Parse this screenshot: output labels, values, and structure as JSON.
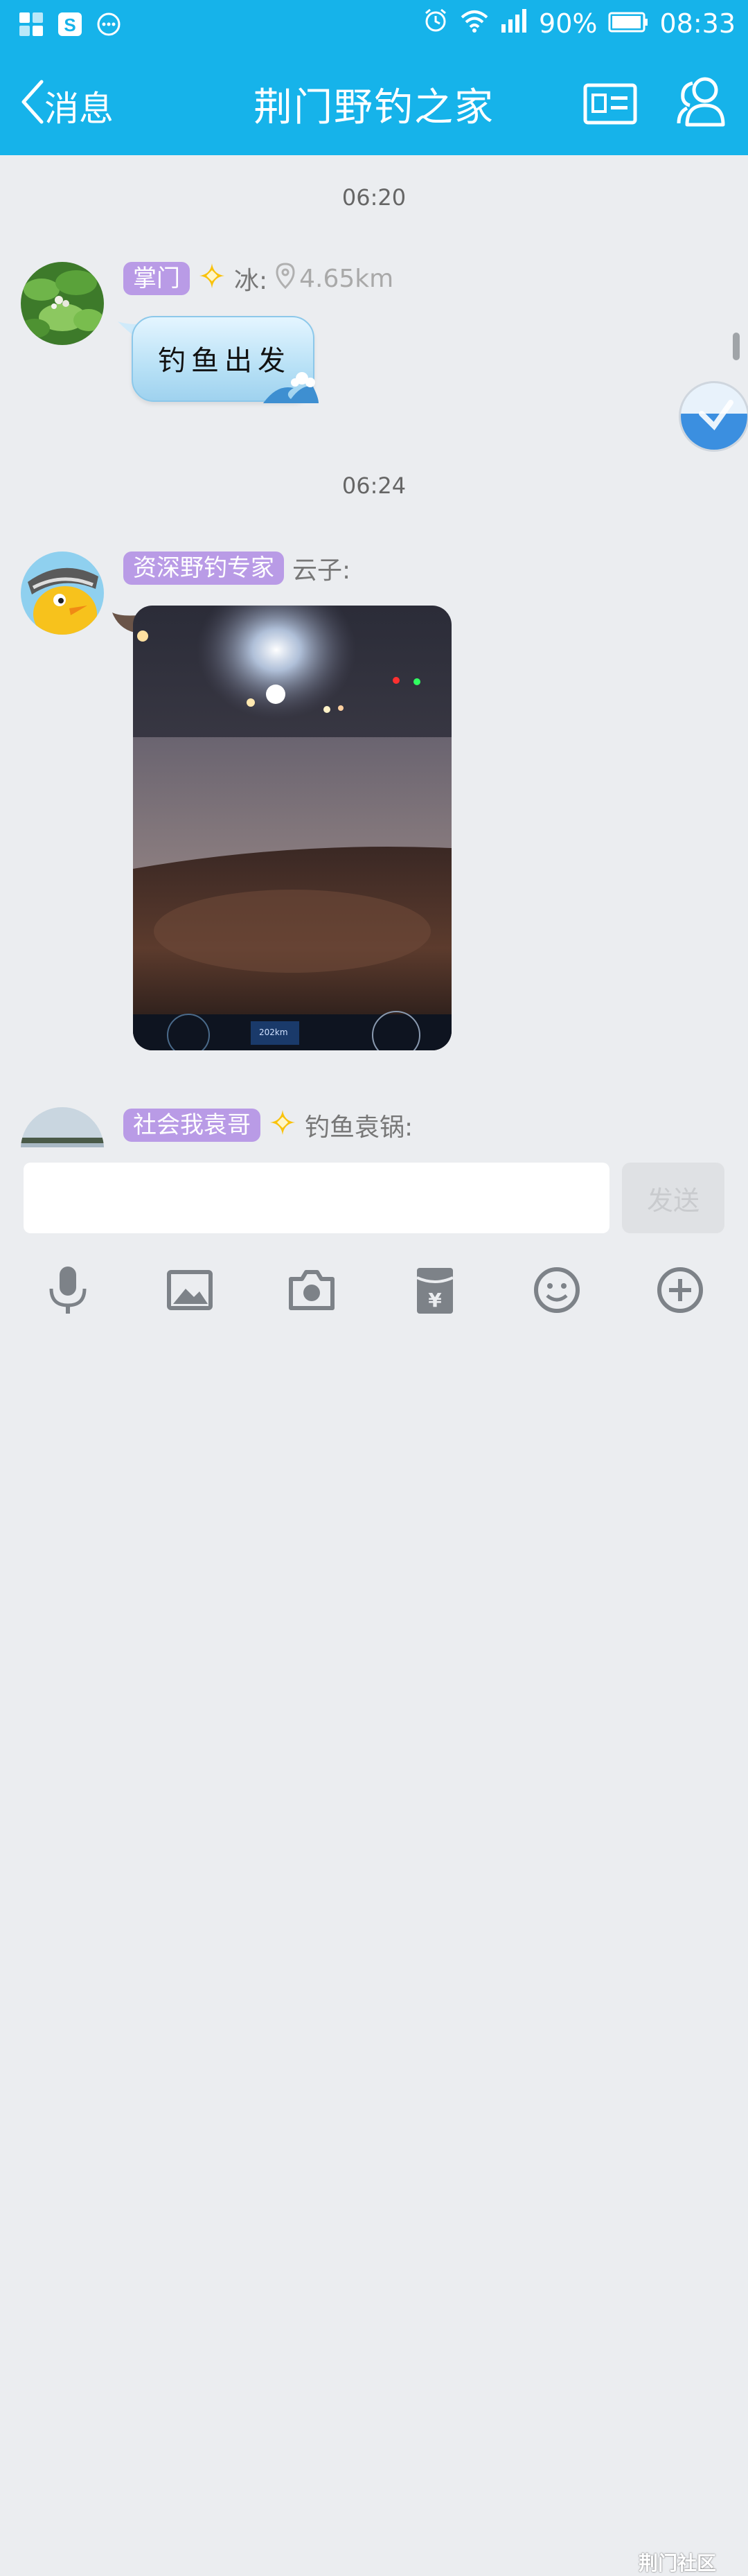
{
  "status_bar": {
    "battery_text": "90%",
    "time": "08:33"
  },
  "nav": {
    "back_label": "消息",
    "title": "荆门野钓之家"
  },
  "messages": [
    {
      "time": "06:20",
      "badge": "掌门",
      "sender": "冰:",
      "distance": "4.65km",
      "text": "钓鱼出发"
    },
    {
      "time": "06:24",
      "badge": "资深野钓专家",
      "sender": "云子:"
    },
    {
      "badge": "社会我袁哥",
      "sender": "钓鱼袁锅:"
    }
  ],
  "input": {
    "send_label": "发送"
  },
  "watermark": "荆门社区"
}
